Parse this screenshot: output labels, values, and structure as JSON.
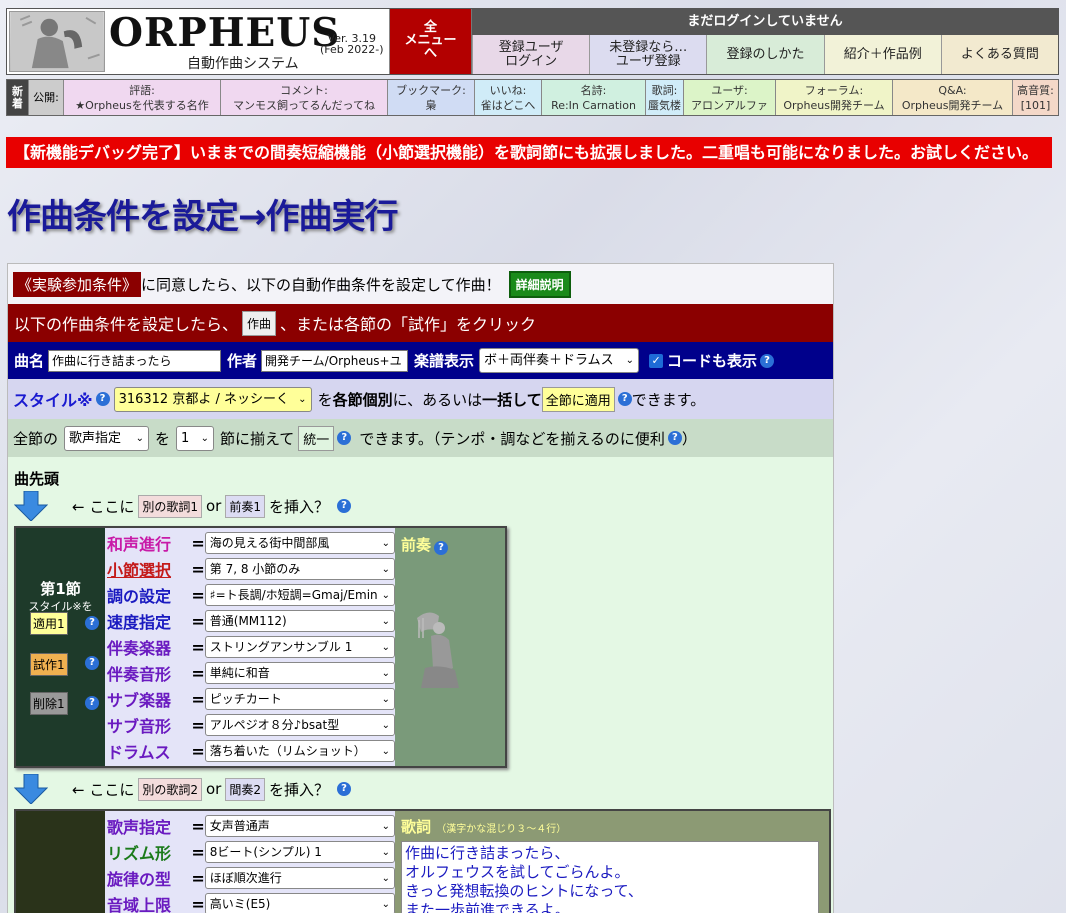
{
  "header": {
    "logo_title": "ORPHEUS",
    "logo_subtitle": "自動作曲システム",
    "version": "Ver. 3.19",
    "version_date": "(Feb 2022-)",
    "menu_all": "全\nメニュー\nへ",
    "login_status": "まだログインしていません",
    "nav": [
      {
        "label": "登録ユーザ\nログイン"
      },
      {
        "label": "未登録なら…\nユーザ登録"
      },
      {
        "label": "登録のしかた"
      },
      {
        "label": "紹介＋作品例"
      },
      {
        "label": "よくある質問"
      }
    ]
  },
  "news": {
    "tag": "新\n着",
    "published": "公開:",
    "items": [
      {
        "h": "評語:",
        "v": "★Orpheusを代表する名作"
      },
      {
        "h": "コメント:",
        "v": "マンモス飼ってるんだってね"
      },
      {
        "h": "ブックマーク:",
        "v": "梟"
      },
      {
        "h": "いいね:",
        "v": "雀はどこへ"
      },
      {
        "h": "名詩:",
        "v": "Re:In Carnation"
      },
      {
        "h": "歌詞:",
        "v": "蜃気楼"
      },
      {
        "h": "ユーザ:",
        "v": "アロンアルファ"
      },
      {
        "h": "フォーラム:",
        "v": "Orpheus開発チーム"
      },
      {
        "h": "Q&A:",
        "v": "Orpheus開発チーム"
      },
      {
        "h": "高音質:",
        "v": "[101]"
      }
    ]
  },
  "announcement": "【新機能デバッグ完了】いままでの間奏短縮機能（小節選択機能）を歌詞節にも拡張しました。二重唱も可能になりました。お試しください。",
  "page_title": "作曲条件を設定→作曲実行",
  "panel": {
    "agree_link": "《実験参加条件》",
    "agree_text": "に同意したら、以下の自動作曲条件を設定して作曲！",
    "detail_button": "詳細説明",
    "instr_pre": "以下の作曲条件を設定したら、",
    "compose_button": "作曲",
    "instr_post": "、または各節の「試作」をクリック",
    "song_label": "曲名",
    "song_value": "作曲に行き詰まったら",
    "author_label": "作者",
    "author_value": "開発チーム/Orpheus+ユ",
    "score_label": "楽譜表示",
    "score_value": "ボ＋両伴奏＋ドラムス",
    "chord_label": "コードも表示",
    "style_label": "スタイル※",
    "style_value": "316312 京都よ / ネッシーく",
    "style_mid1": "を",
    "style_bold1": "各節個別",
    "style_mid2": "に、あるいは",
    "style_bold2": "一括して",
    "apply_all_button": "全節に適用",
    "style_end": "できます。",
    "all_pre": "全節の",
    "all_select": "歌声指定",
    "all_mid": "を",
    "all_num": "1",
    "all_mid2": "節に揃えて",
    "unify_button": "統一",
    "all_end": "できます。（テンポ・調などを揃えるのに便利",
    "all_end2": "）",
    "head_label": "曲先頭",
    "insert1": {
      "pre": "← ここに",
      "b1": "別の歌詞1",
      "or": "or",
      "b2": "前奏1",
      "post": "を挿入？"
    },
    "insert2": {
      "pre": "← ここに",
      "b1": "別の歌詞2",
      "or": "or",
      "b2": "間奏2",
      "post": "を挿入？"
    }
  },
  "section1": {
    "title": "第1節",
    "subtitle": "スタイル※を",
    "apply_button": "適用1",
    "try_button": "試作1",
    "delete_button": "削除1",
    "right_label": "前奏",
    "fields": [
      {
        "label": "和声進行",
        "value": "海の見える街中間部風"
      },
      {
        "label": "小節選択",
        "value": "第 7, 8 小節のみ"
      },
      {
        "label": "調の設定",
        "value": "♯=ト長調/ホ短調=Gmaj/Emin"
      },
      {
        "label": "速度指定",
        "value": "普通(MM112)"
      },
      {
        "label": "伴奏楽器",
        "value": "ストリングアンサンブル 1"
      },
      {
        "label": "伴奏音形",
        "value": "単純に和音"
      },
      {
        "label": "サブ楽器",
        "value": "ピッチカート"
      },
      {
        "label": "サブ音形",
        "value": "アルペジオ８分♪bsat型"
      },
      {
        "label": "ドラムス",
        "value": "落ち着いた（リムショット）"
      }
    ]
  },
  "section2": {
    "lyric_label": "歌詞",
    "lyric_note": "（漢字かな混じり３～４行）",
    "lyrics": "作曲に行き詰まったら、\nオルフェウスを試してごらんよ。\nきっと発想転換のヒントになって、\nまた一歩前進できるよ。",
    "fields": [
      {
        "label": "歌声指定",
        "value": "女声普通声"
      },
      {
        "label": "リズム形",
        "value": "8ビート(シンプル) 1"
      },
      {
        "label": "旋律の型",
        "value": "ほぼ順次進行"
      },
      {
        "label": "音域上限",
        "value": "高いミ(E5)"
      }
    ]
  },
  "colors": {
    "accent_red": "#8b0000",
    "announce_red": "#e80000",
    "navy": "#00008b",
    "title_blue": "#1a1a99"
  }
}
